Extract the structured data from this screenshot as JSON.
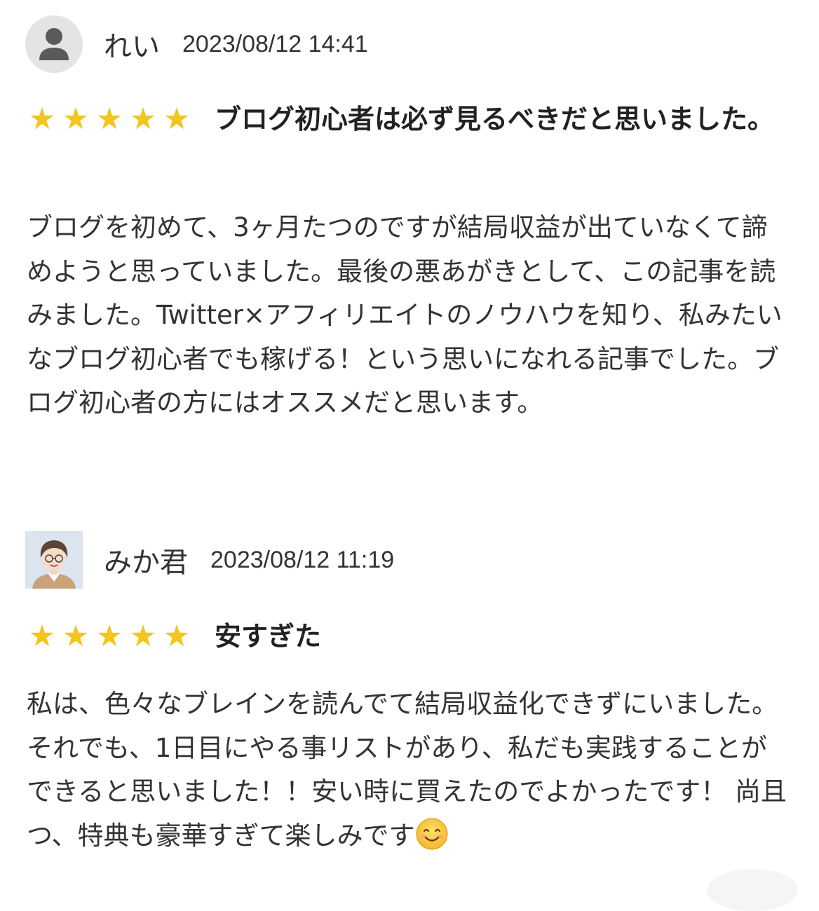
{
  "reviews": [
    {
      "user_name": "れい",
      "date": "2023/08/12 14:41",
      "avatar_icon": "user-silhouette-icon",
      "rating": 5,
      "stars": [
        "★",
        "★",
        "★",
        "★",
        "★"
      ],
      "title": "ブログ初心者は必ず見るべきだと思いました。",
      "body": "ブログを初めて、3ヶ月たつのですが結局収益が出ていなくて諦めようと思っていました。最後の悪あがきとして、この記事を読みました。Twitter×アフィリエイトのノウハウを知り、私みたいなブログ初心者でも稼げる！という思いになれる記事でした。ブログ初心者の方にはオススメだと思います。"
    },
    {
      "user_name": "みか君",
      "date": "2023/08/12 11:19",
      "avatar_icon": "cartoon-avatar-icon",
      "rating": 5,
      "stars": [
        "★",
        "★",
        "★",
        "★",
        "★"
      ],
      "title": "安すぎた",
      "body": "私は、色々なブレインを読んでて結局収益化できずにいました。それでも、1日目にやる事リストがあり、私だも実践することができると思いました！！安い時に買えたのでよかったです！ 尚且つ、特典も豪華すぎて楽しみです",
      "trailing_icon": "smiling-face-emoji-icon"
    }
  ],
  "colors": {
    "star": "#f4c51e",
    "text": "#333333",
    "avatar_bg": "#e4e4e4"
  }
}
